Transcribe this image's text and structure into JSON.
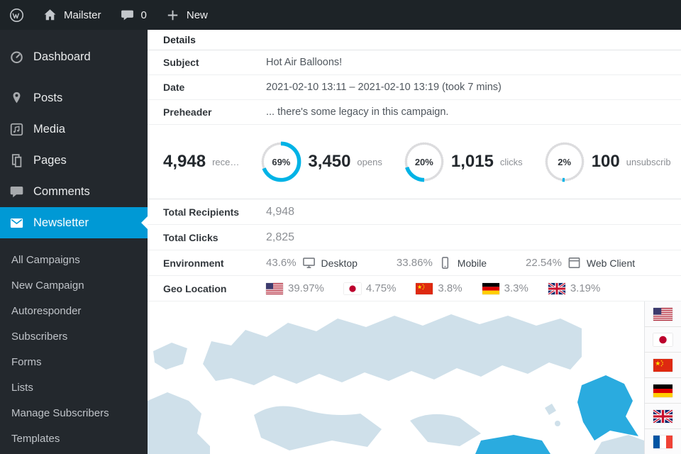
{
  "admin_bar": {
    "site_name": "Mailster",
    "comments_count": "0",
    "new_label": "New"
  },
  "sidebar": {
    "items": [
      {
        "label": "Dashboard"
      },
      {
        "label": "Posts"
      },
      {
        "label": "Media"
      },
      {
        "label": "Pages"
      },
      {
        "label": "Comments"
      },
      {
        "label": "Newsletter"
      }
    ],
    "submenu": [
      {
        "label": "All Campaigns"
      },
      {
        "label": "New Campaign"
      },
      {
        "label": "Autoresponder"
      },
      {
        "label": "Subscribers"
      },
      {
        "label": "Forms"
      },
      {
        "label": "Lists"
      },
      {
        "label": "Manage Subscribers"
      },
      {
        "label": "Templates"
      }
    ]
  },
  "panel": {
    "title": "Details"
  },
  "details": {
    "rows": [
      {
        "label": "Subject",
        "value": "Hot Air Balloons!"
      },
      {
        "label": "Date",
        "value": "2021-02-10 13:11 – 2021-02-10 13:19 (took 7 mins)"
      },
      {
        "label": "Preheader",
        "value": "... there's some legacy in this campaign."
      }
    ],
    "stats": [
      {
        "value": "4,948",
        "label": "rece…"
      },
      {
        "percent": "69%",
        "value": "3,450",
        "label": "opens"
      },
      {
        "percent": "20%",
        "value": "1,015",
        "label": "clicks"
      },
      {
        "percent": "2%",
        "value": "100",
        "label": "unsubscrib"
      }
    ],
    "totals": [
      {
        "label": "Total Recipients",
        "value": "4,948"
      },
      {
        "label": "Total Clicks",
        "value": "2,825"
      }
    ],
    "environment": {
      "label": "Environment",
      "items": [
        {
          "percent": "43.6%",
          "label": "Desktop"
        },
        {
          "percent": "33.86%",
          "label": "Mobile"
        },
        {
          "percent": "22.54%",
          "label": "Web Client"
        }
      ]
    },
    "geo": {
      "label": "Geo Location",
      "items": [
        {
          "country": "United States",
          "code": "us",
          "percent": "39.97%"
        },
        {
          "country": "Japan",
          "code": "jp",
          "percent": "4.75%"
        },
        {
          "country": "China",
          "code": "cn",
          "percent": "3.8%"
        },
        {
          "country": "Germany",
          "code": "de",
          "percent": "3.3%"
        },
        {
          "country": "United Kingdom",
          "code": "gb",
          "percent": "3.19%"
        }
      ]
    }
  },
  "colors": {
    "admin_bar_bg": "#1d2327",
    "sidebar_bg": "#23282d",
    "menu_active": "#0099d5",
    "chart_blue": "#00b3e6",
    "map_land": "#cfe0ea",
    "map_highlight": "#2aabdf"
  }
}
